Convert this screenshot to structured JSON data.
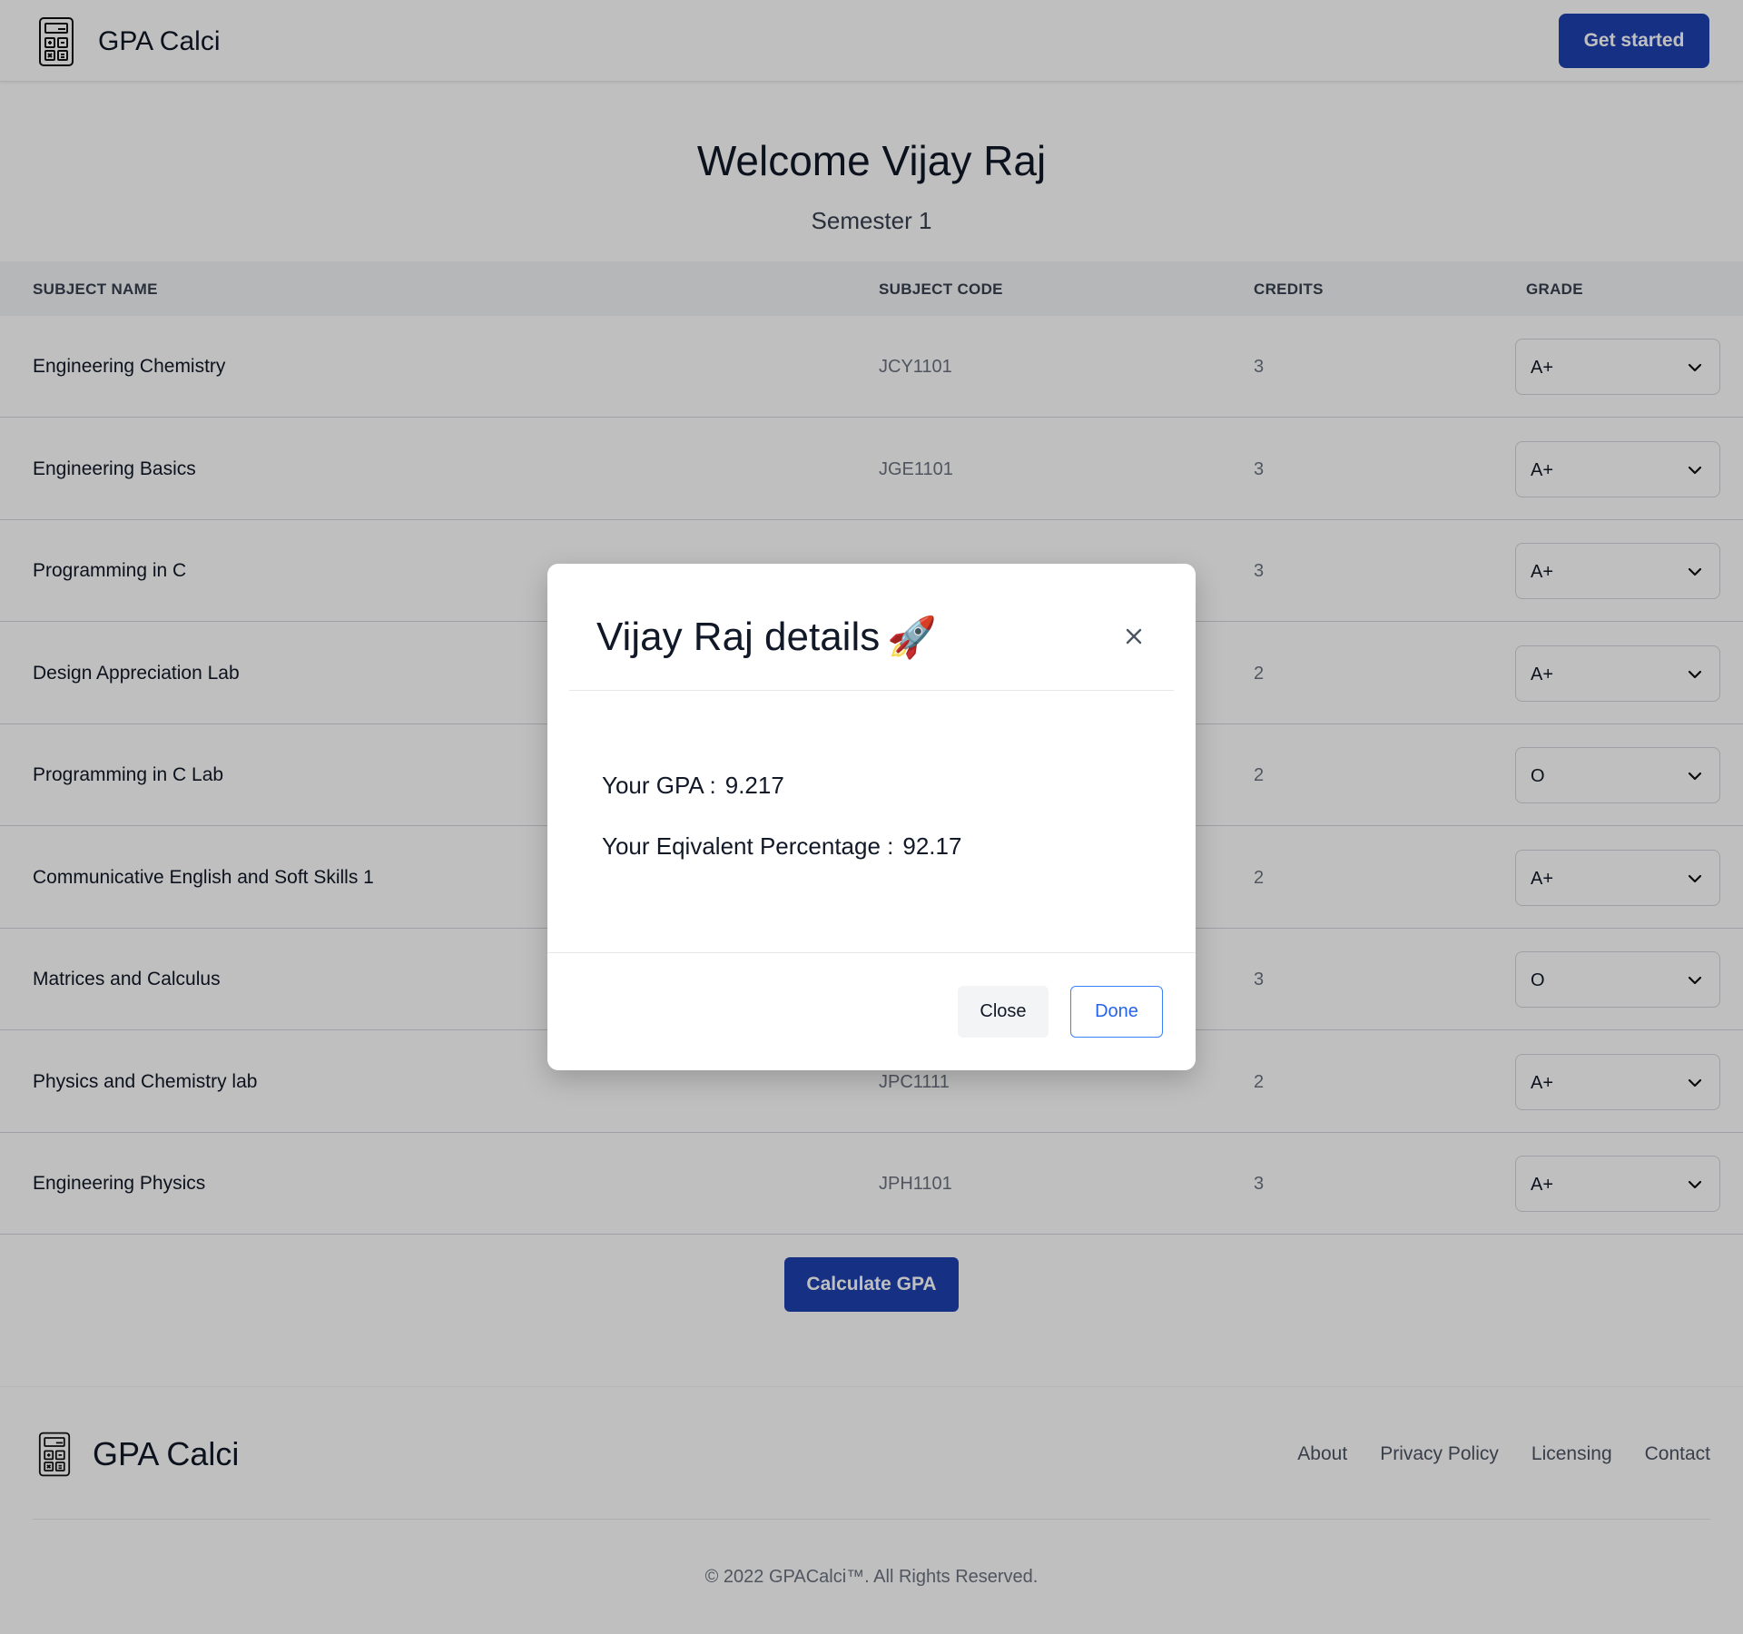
{
  "header": {
    "brand": "GPA Calci",
    "cta_label": "Get started"
  },
  "welcome": {
    "title": "Welcome Vijay Raj",
    "semester": "Semester 1"
  },
  "table": {
    "headers": [
      "SUBJECT NAME",
      "SUBJECT CODE",
      "CREDITS",
      "GRADE"
    ],
    "rows": [
      {
        "name": "Engineering Chemistry",
        "code": "JCY1101",
        "credits": "3",
        "grade": "A+"
      },
      {
        "name": "Engineering Basics",
        "code": "JGE1101",
        "credits": "3",
        "grade": "A+"
      },
      {
        "name": "Programming in C",
        "code": "",
        "credits": "3",
        "grade": "A+"
      },
      {
        "name": "Design Appreciation Lab",
        "code": "",
        "credits": "2",
        "grade": "A+"
      },
      {
        "name": "Programming in C Lab",
        "code": "",
        "credits": "2",
        "grade": "O"
      },
      {
        "name": "Communicative English and Soft Skills 1",
        "code": "",
        "credits": "2",
        "grade": "A+"
      },
      {
        "name": "Matrices and Calculus",
        "code": "",
        "credits": "3",
        "grade": "O"
      },
      {
        "name": "Physics and Chemistry lab",
        "code": "JPC1111",
        "credits": "2",
        "grade": "A+"
      },
      {
        "name": "Engineering Physics",
        "code": "JPH1101",
        "credits": "3",
        "grade": "A+"
      }
    ]
  },
  "calculate_label": "Calculate GPA",
  "footer": {
    "brand": "GPA Calci",
    "links": [
      "About",
      "Privacy Policy",
      "Licensing",
      "Contact"
    ],
    "copyright": "© 2022 GPACalci™. All Rights Reserved."
  },
  "modal": {
    "title": "Vijay Raj details",
    "title_emoji": "🚀",
    "gpa_label": "Your GPA :",
    "gpa_value": "9.217",
    "percentage_label": "Your Eqivalent Percentage :",
    "percentage_value": "92.17",
    "close_label": "Close",
    "done_label": "Done"
  },
  "colors": {
    "primary": "#1e40af",
    "overlay": "rgba(0,0,0,0.25)",
    "done_accent": "#2563eb"
  }
}
